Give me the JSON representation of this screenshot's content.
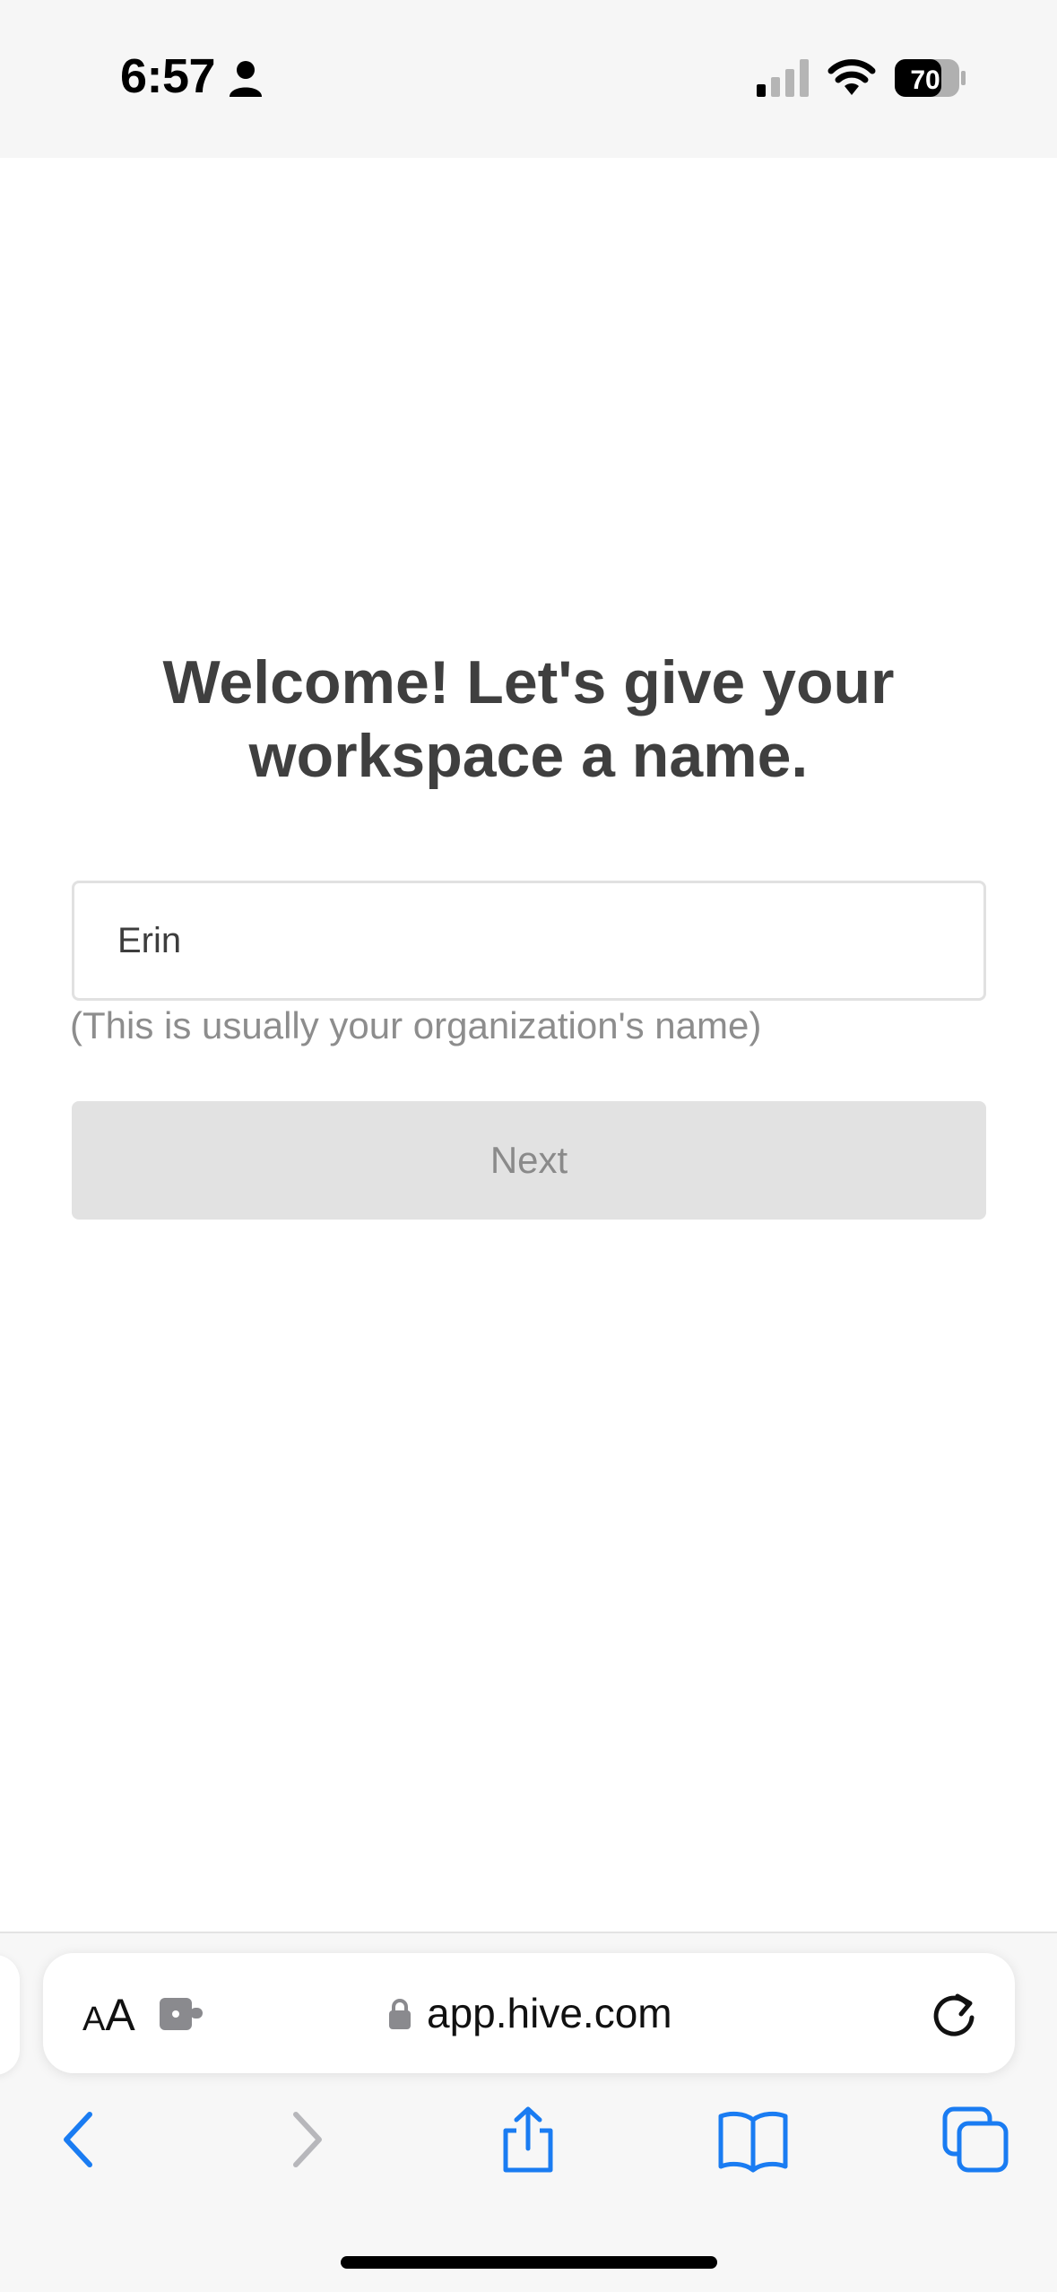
{
  "status_bar": {
    "time": "6:57",
    "battery_level": "70",
    "icons": [
      "person-icon",
      "cellular-signal-icon",
      "wifi-icon",
      "battery-icon"
    ]
  },
  "main": {
    "heading_line1": "Welcome! Let's give your",
    "heading_line2": "workspace a name.",
    "workspace_name_value": "Erin",
    "hint": "(This is usually your organization's name)",
    "next_label": "Next"
  },
  "browser": {
    "text_size_label_small": "A",
    "text_size_label_large": "A",
    "url": "app.hive.com",
    "toolbar_icons": [
      "back-icon",
      "forward-icon",
      "share-icon",
      "bookmarks-icon",
      "tabs-icon"
    ]
  },
  "colors": {
    "accent_blue": "#1a7cf2",
    "disabled_button_bg": "#e2e2e2",
    "heading_text": "#3f3f3f",
    "hint_text": "#8d8d8d"
  }
}
